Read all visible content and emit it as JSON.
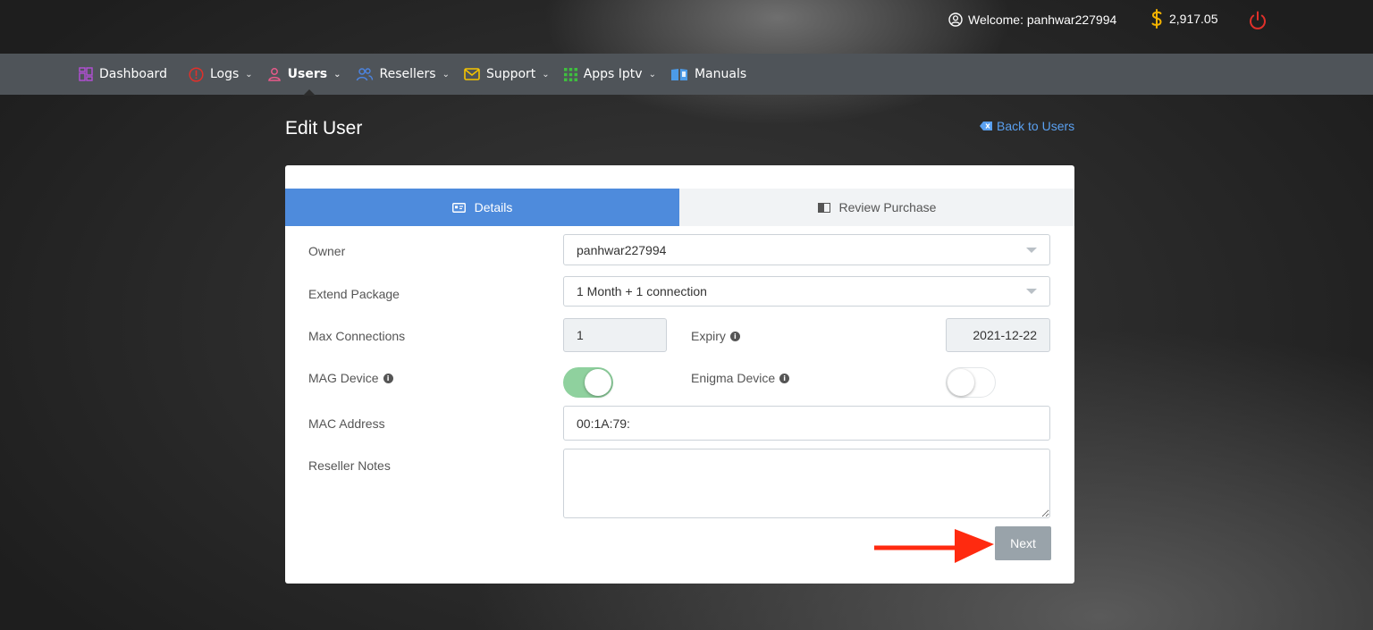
{
  "header": {
    "welcome_label": "Welcome: panhwar227994",
    "balance": "2,917.05",
    "icons": {
      "user": "user-circle-icon",
      "currency": "dollar-icon",
      "power": "power-icon"
    },
    "colors": {
      "currency": "#f5b300",
      "power": "#e0302a"
    }
  },
  "nav": {
    "items": [
      {
        "label": "Dashboard",
        "icon": "dashboard-grid-icon",
        "color": "#b44fd8",
        "dropdown": false
      },
      {
        "label": "Logs",
        "icon": "info-circle-icon",
        "color": "#e0302a",
        "dropdown": true
      },
      {
        "label": "Users",
        "icon": "user-icon",
        "color": "#e85a8a",
        "dropdown": true,
        "active": true
      },
      {
        "label": "Resellers",
        "icon": "users-icon",
        "color": "#4c84e0",
        "dropdown": true
      },
      {
        "label": "Support",
        "icon": "envelope-icon",
        "color": "#f5c400",
        "dropdown": true
      },
      {
        "label": "Apps Iptv",
        "icon": "apps-grid-icon",
        "color": "#3fbf3f",
        "dropdown": true
      },
      {
        "label": "Manuals",
        "icon": "book-icon",
        "color": "#4c9be8",
        "dropdown": false
      }
    ]
  },
  "page": {
    "title": "Edit User",
    "back_label": "Back to Users"
  },
  "tabs": [
    {
      "label": "Details",
      "icon": "id-card-icon",
      "active": true
    },
    {
      "label": "Review Purchase",
      "icon": "book-open-icon",
      "active": false
    }
  ],
  "form": {
    "owner": {
      "label": "Owner",
      "value": "panhwar227994"
    },
    "extend_package": {
      "label": "Extend Package",
      "value": "1 Month + 1 connection"
    },
    "max_connections": {
      "label": "Max Connections",
      "value": "1"
    },
    "expiry": {
      "label": "Expiry",
      "value": "2021-12-22"
    },
    "mag_device": {
      "label": "MAG Device",
      "on": true
    },
    "enigma_device": {
      "label": "Enigma Device",
      "on": false
    },
    "mac_address": {
      "label": "MAC Address",
      "value": "00:1A:79:"
    },
    "reseller_notes": {
      "label": "Reseller Notes",
      "value": ""
    },
    "next_label": "Next"
  },
  "annotation": {
    "arrow_color": "#ff2a0f"
  }
}
